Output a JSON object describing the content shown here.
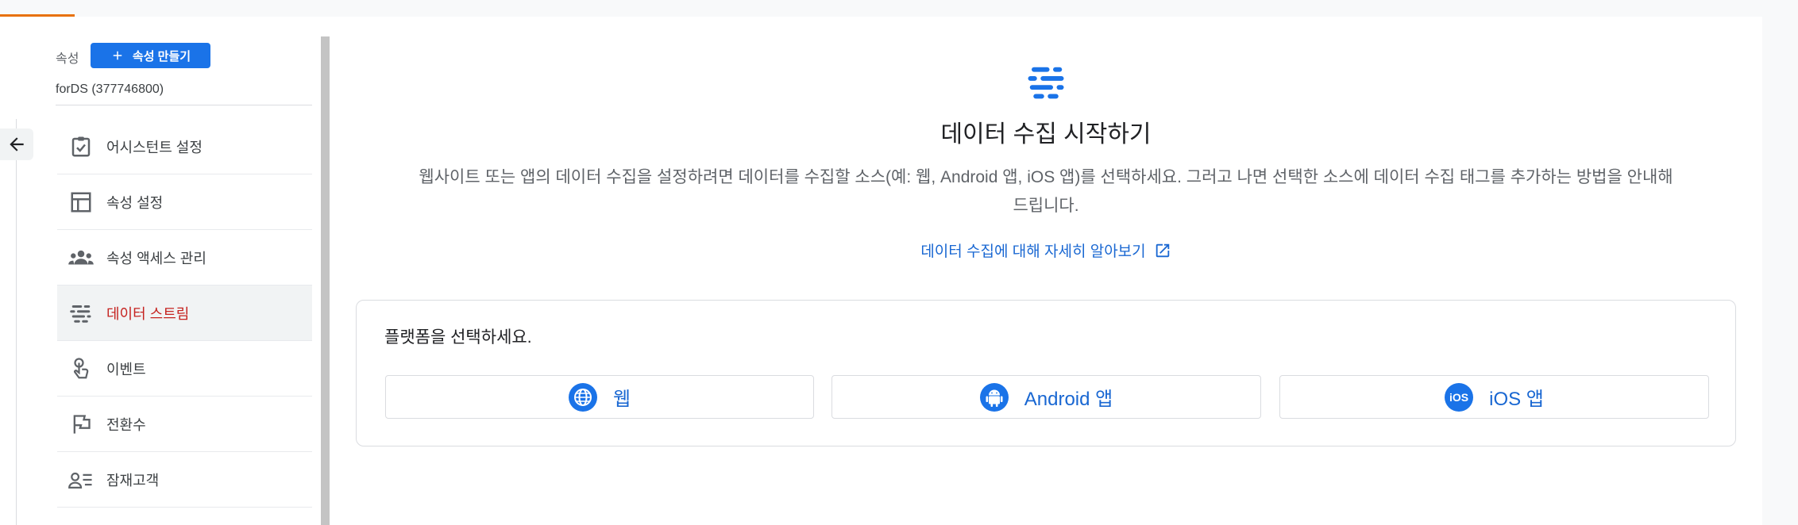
{
  "sidebar": {
    "property_label": "속성",
    "create_button_label": "속성 만들기",
    "property_name": "forDS (377746800)",
    "items": [
      {
        "label": "어시스턴트 설정",
        "icon": "assistant-checklist-icon"
      },
      {
        "label": "속성 설정",
        "icon": "property-layout-icon"
      },
      {
        "label": "속성 액세스 관리",
        "icon": "people-group-icon"
      },
      {
        "label": "데이터 스트림",
        "icon": "data-stream-icon",
        "active": true
      },
      {
        "label": "이벤트",
        "icon": "touch-gesture-icon"
      },
      {
        "label": "전환수",
        "icon": "flag-icon"
      },
      {
        "label": "잠재고객",
        "icon": "audience-icon"
      }
    ]
  },
  "main": {
    "title": "데이터 수집 시작하기",
    "description": "웹사이트 또는 앱의 데이터 수집을 설정하려면 데이터를 수집할 소스(예: 웹, Android 앱, iOS 앱)를 선택하세요. 그러고 나면 선택한 소스에 데이터 수집 태그를 추가하는 방법을 안내해드립니다.",
    "learn_more_link": "데이터 수집에 대해 자세히 알아보기",
    "platform_prompt": "플랫폼을 선택하세요.",
    "platforms": [
      {
        "label": "웹",
        "icon": "globe-icon"
      },
      {
        "label": "Android 앱",
        "icon": "android-icon"
      },
      {
        "label": "iOS 앱",
        "icon": "ios-icon"
      }
    ]
  },
  "colors": {
    "accent": "#1a73e8",
    "link": "#1967d2",
    "active_nav_text": "#c5221f",
    "progress": "#e8710a"
  }
}
